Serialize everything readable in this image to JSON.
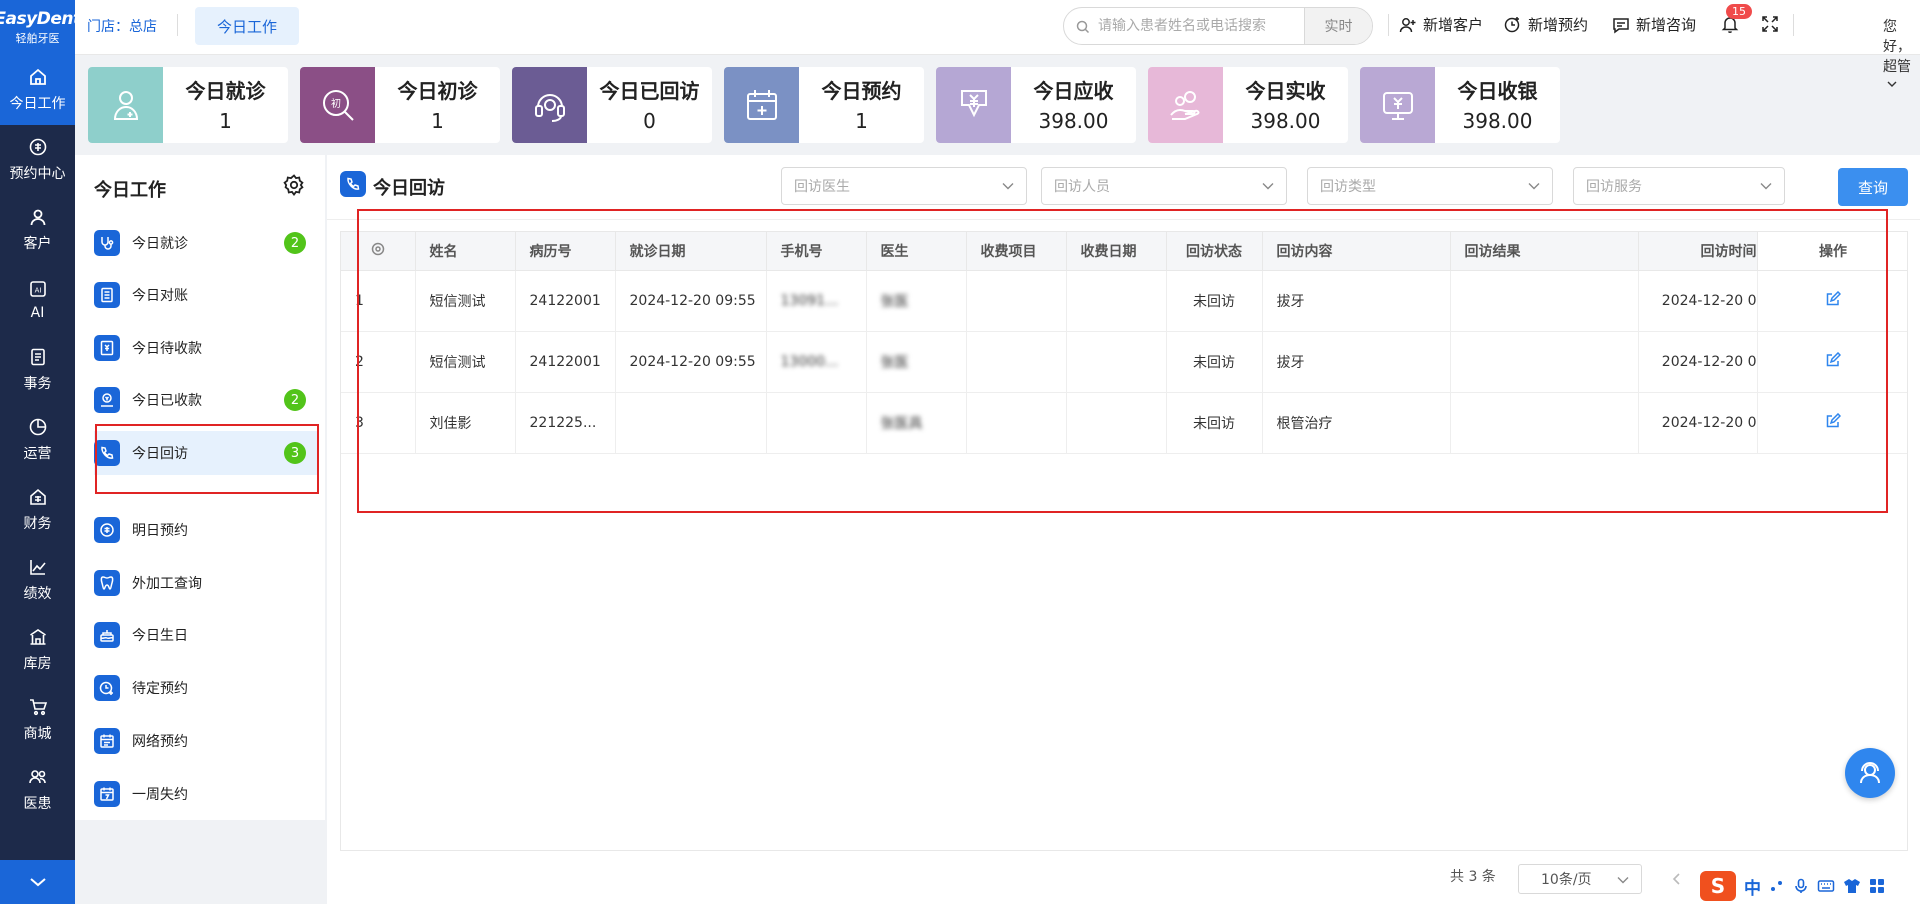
{
  "brand": {
    "name": "EasyDent",
    "sub": "轻舶牙医"
  },
  "leftnav": [
    {
      "label": "今日工作",
      "icon": "home-icon"
    },
    {
      "label": "预约中心",
      "icon": "appointment-icon"
    },
    {
      "label": "客户",
      "icon": "user-icon"
    },
    {
      "label": "AI",
      "icon": "ai-icon"
    },
    {
      "label": "事务",
      "icon": "task-icon"
    },
    {
      "label": "运营",
      "icon": "pie-icon"
    },
    {
      "label": "财务",
      "icon": "finance-icon"
    },
    {
      "label": "绩效",
      "icon": "chart-icon"
    },
    {
      "label": "库房",
      "icon": "warehouse-icon"
    },
    {
      "label": "商城",
      "icon": "cart-icon"
    },
    {
      "label": "医患",
      "icon": "doctor-patient-icon"
    }
  ],
  "topbar": {
    "store": "门店：总店",
    "active_tab": "今日工作",
    "search_placeholder": "请输入患者姓名或电话搜索",
    "search_button": "实时",
    "actions": [
      "新增客户",
      "新增预约",
      "新增咨询"
    ],
    "bell_count": "15",
    "greeting": "您好，超管"
  },
  "stats": [
    {
      "title": "今日就诊",
      "value": "1",
      "color": "#8ecfcb"
    },
    {
      "title": "今日初诊",
      "value": "1",
      "color": "#8b4f86"
    },
    {
      "title": "今日已回访",
      "value": "0",
      "color": "#6b5c94"
    },
    {
      "title": "今日预约",
      "value": "1",
      "color": "#7b91c4"
    },
    {
      "title": "今日应收",
      "value": "398.00",
      "color": "#b5a7d4"
    },
    {
      "title": "今日实收",
      "value": "398.00",
      "color": "#e7b8d8"
    },
    {
      "title": "今日收银",
      "value": "398.00",
      "color": "#b9a8d4"
    }
  ],
  "sidebar": {
    "title": "今日工作",
    "items": [
      {
        "label": "今日就诊",
        "badge": "2"
      },
      {
        "label": "今日对账",
        "badge": ""
      },
      {
        "label": "今日待收款",
        "badge": ""
      },
      {
        "label": "今日已收款",
        "badge": "2"
      },
      {
        "label": "今日回访",
        "badge": "3"
      },
      {
        "label": "明日预约",
        "badge": ""
      },
      {
        "label": "外加工查询",
        "badge": ""
      },
      {
        "label": "今日生日",
        "badge": ""
      },
      {
        "label": "待定预约",
        "badge": ""
      },
      {
        "label": "网络预约",
        "badge": ""
      },
      {
        "label": "一周失约",
        "badge": ""
      }
    ]
  },
  "main": {
    "title": "今日回访",
    "filters": [
      "回访医生",
      "回访人员",
      "回访类型",
      "回访服务"
    ],
    "query_button": "查询",
    "columns": [
      "姓名",
      "病历号",
      "就诊日期",
      "手机号",
      "医生",
      "收费项目",
      "收费日期",
      "回访状态",
      "回访内容",
      "回访结果",
      "回访时间",
      "操作"
    ],
    "rows": [
      {
        "idx": "1",
        "name": "短信测试",
        "record": "24122001",
        "visit": "2024-12-20 09:55",
        "phone": "13091...",
        "doctor": "张医",
        "fee_item": "",
        "fee_date": "",
        "status": "未回访",
        "content": "拔牙",
        "result": "",
        "time": "2024-12-20 0"
      },
      {
        "idx": "2",
        "name": "短信测试",
        "record": "24122001",
        "visit": "2024-12-20 09:55",
        "phone": "13000...",
        "doctor": "张医",
        "fee_item": "",
        "fee_date": "",
        "status": "未回访",
        "content": "拔牙",
        "result": "",
        "time": "2024-12-20 0"
      },
      {
        "idx": "3",
        "name": "刘佳影",
        "record": "221225...",
        "visit": "",
        "phone": "",
        "doctor": "张医具",
        "fee_item": "",
        "fee_date": "",
        "status": "未回访",
        "content": "根管治疗",
        "result": "",
        "time": "2024-12-20 0"
      }
    ]
  },
  "pagination": {
    "total": "共 3 条",
    "page_size": "10条/页"
  },
  "ime": {
    "mode": "中"
  }
}
